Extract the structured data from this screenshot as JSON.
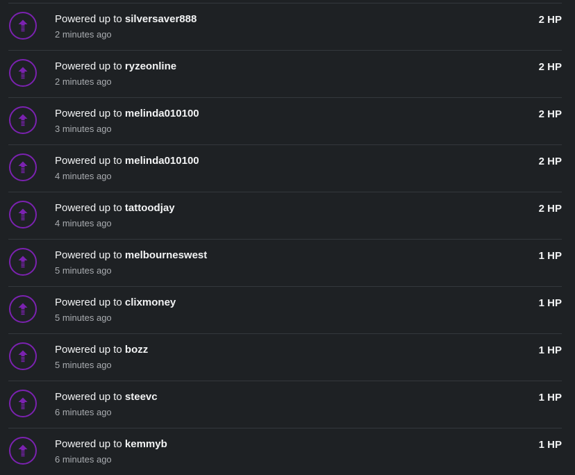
{
  "colors": {
    "background": "#1e2124",
    "accent": "#7b22b0",
    "text": "#f2f3f4",
    "muted": "#a9acb0",
    "divider": "#34383d"
  },
  "icon": "power-up-arrow-icon",
  "rows": [
    {
      "prefix": "Powered up to ",
      "user": "silversaver888",
      "time": "2 minutes ago",
      "amount": "2 HP"
    },
    {
      "prefix": "Powered up to ",
      "user": "ryzeonline",
      "time": "2 minutes ago",
      "amount": "2 HP"
    },
    {
      "prefix": "Powered up to ",
      "user": "melinda010100",
      "time": "3 minutes ago",
      "amount": "2 HP"
    },
    {
      "prefix": "Powered up to ",
      "user": "melinda010100",
      "time": "4 minutes ago",
      "amount": "2 HP"
    },
    {
      "prefix": "Powered up to ",
      "user": "tattoodjay",
      "time": "4 minutes ago",
      "amount": "2 HP"
    },
    {
      "prefix": "Powered up to ",
      "user": "melbourneswest",
      "time": "5 minutes ago",
      "amount": "1 HP"
    },
    {
      "prefix": "Powered up to ",
      "user": "clixmoney",
      "time": "5 minutes ago",
      "amount": "1 HP"
    },
    {
      "prefix": "Powered up to ",
      "user": "bozz",
      "time": "5 minutes ago",
      "amount": "1 HP"
    },
    {
      "prefix": "Powered up to ",
      "user": "steevc",
      "time": "6 minutes ago",
      "amount": "1 HP"
    },
    {
      "prefix": "Powered up to ",
      "user": "kemmyb",
      "time": "6 minutes ago",
      "amount": "1 HP"
    }
  ]
}
